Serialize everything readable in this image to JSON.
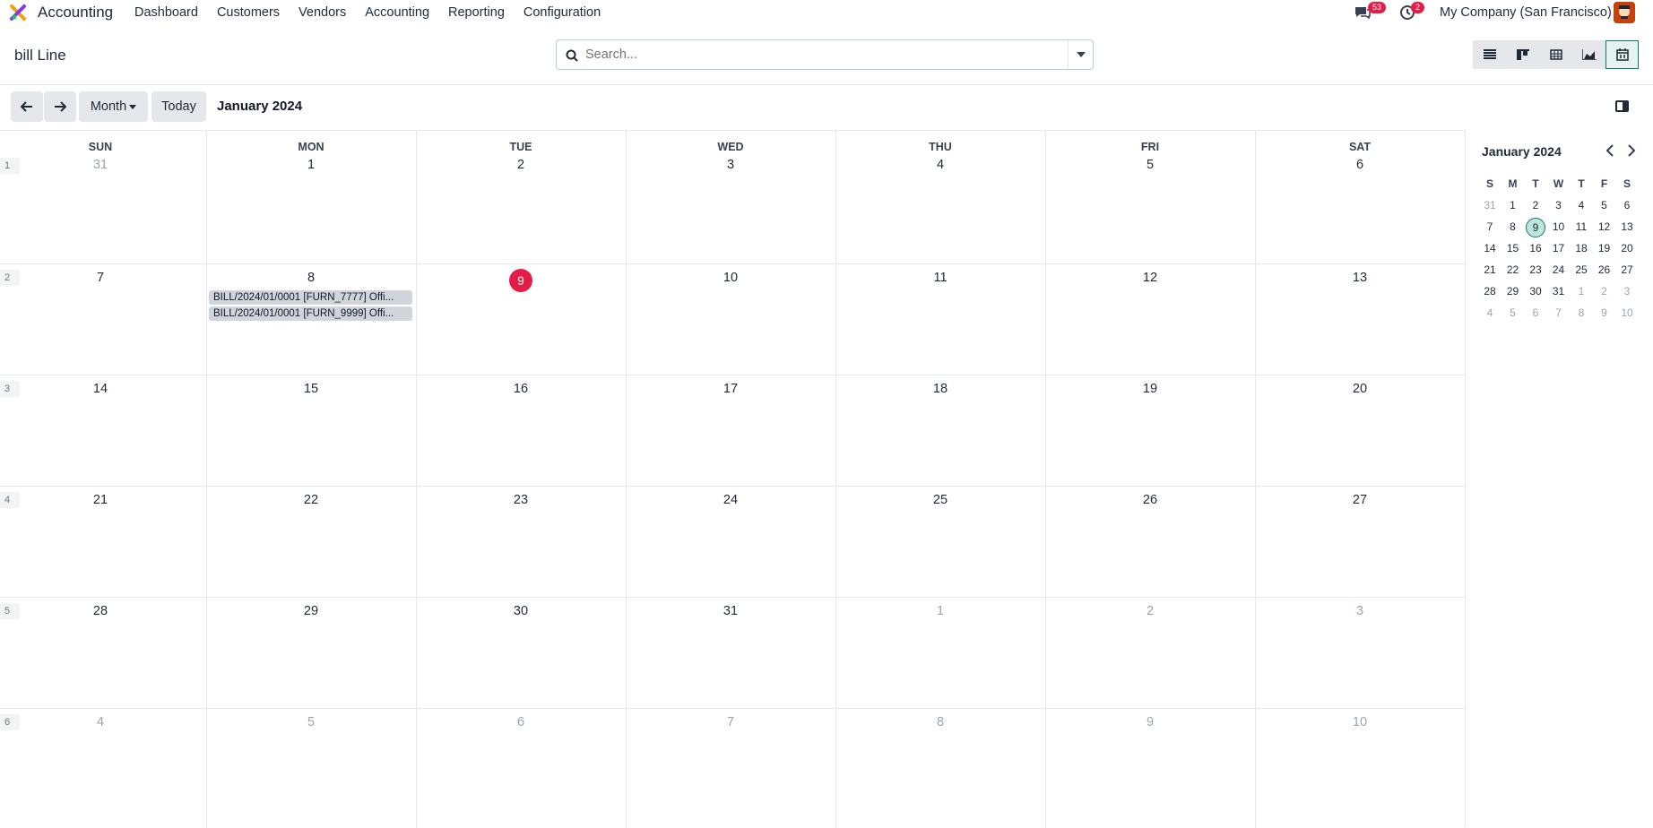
{
  "app": {
    "name": "Accounting",
    "menu": [
      "Dashboard",
      "Customers",
      "Vendors",
      "Accounting",
      "Reporting",
      "Configuration"
    ],
    "company": "My Company (San Francisco)",
    "messages_count": "53",
    "activities_count": "2"
  },
  "control": {
    "breadcrumb": "bill Line",
    "search_placeholder": "Search..."
  },
  "toolbar": {
    "scale_label": "Month",
    "today_label": "Today",
    "period": "January 2024"
  },
  "calendar": {
    "days": [
      "SUN",
      "MON",
      "TUE",
      "WED",
      "THU",
      "FRI",
      "SAT"
    ],
    "weeks": [
      {
        "num": "1",
        "dates": [
          "31",
          "1",
          "2",
          "3",
          "4",
          "5",
          "6"
        ],
        "muted": [
          true,
          false,
          false,
          false,
          false,
          false,
          false
        ]
      },
      {
        "num": "2",
        "dates": [
          "7",
          "8",
          "9",
          "10",
          "11",
          "12",
          "13"
        ],
        "muted": [
          false,
          false,
          false,
          false,
          false,
          false,
          false
        ]
      },
      {
        "num": "3",
        "dates": [
          "14",
          "15",
          "16",
          "17",
          "18",
          "19",
          "20"
        ],
        "muted": [
          false,
          false,
          false,
          false,
          false,
          false,
          false
        ]
      },
      {
        "num": "4",
        "dates": [
          "21",
          "22",
          "23",
          "24",
          "25",
          "26",
          "27"
        ],
        "muted": [
          false,
          false,
          false,
          false,
          false,
          false,
          false
        ]
      },
      {
        "num": "5",
        "dates": [
          "28",
          "29",
          "30",
          "31",
          "1",
          "2",
          "3"
        ],
        "muted": [
          false,
          false,
          false,
          false,
          true,
          true,
          true
        ]
      },
      {
        "num": "6",
        "dates": [
          "4",
          "5",
          "6",
          "7",
          "8",
          "9",
          "10"
        ],
        "muted": [
          true,
          true,
          true,
          true,
          true,
          true,
          true
        ]
      }
    ],
    "today": "9",
    "events": [
      "BILL/2024/01/0001 [FURN_7777] Offi...",
      "BILL/2024/01/0001 [FURN_9999] Offi..."
    ]
  },
  "mini": {
    "title": "January 2024",
    "headers": [
      "S",
      "M",
      "T",
      "W",
      "T",
      "F",
      "S"
    ],
    "rows": [
      [
        "31",
        "1",
        "2",
        "3",
        "4",
        "5",
        "6"
      ],
      [
        "7",
        "8",
        "9",
        "10",
        "11",
        "12",
        "13"
      ],
      [
        "14",
        "15",
        "16",
        "17",
        "18",
        "19",
        "20"
      ],
      [
        "21",
        "22",
        "23",
        "24",
        "25",
        "26",
        "27"
      ],
      [
        "28",
        "29",
        "30",
        "31",
        "1",
        "2",
        "3"
      ],
      [
        "4",
        "5",
        "6",
        "7",
        "8",
        "9",
        "10"
      ]
    ],
    "selected": "9"
  },
  "colors": {
    "accent": "#0f766e",
    "today": "#e11d48"
  }
}
